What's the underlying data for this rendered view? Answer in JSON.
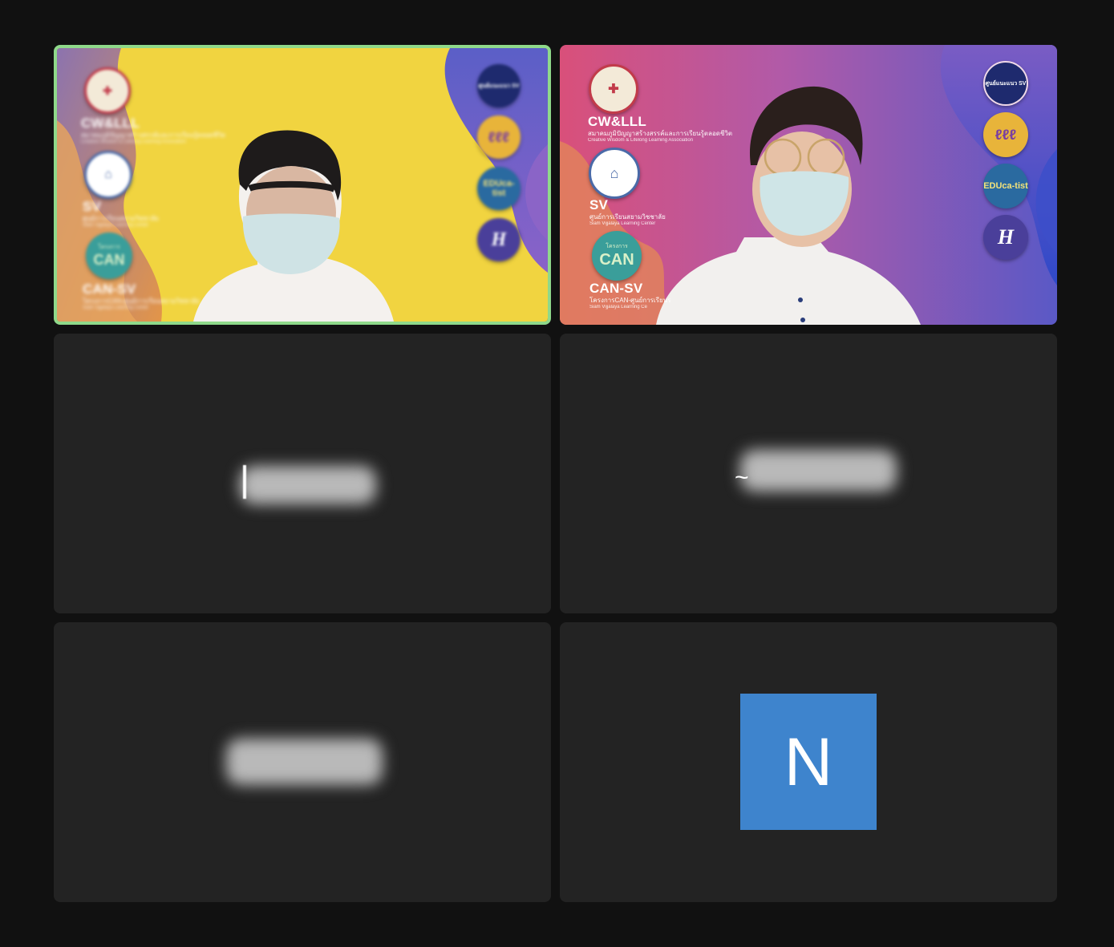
{
  "participants": [
    {
      "tile": 1,
      "active_speaker": true,
      "video_on": true,
      "background": {
        "brand_1": {
          "code": "CW&LLL",
          "thai": "สมาคมภูมิปัญญาสร้างสรรค์และการเรียนรู้ตลอดชีวิต",
          "english": "Creative Wisdom & Lifelong Learning Association"
        },
        "brand_2": {
          "code": "SV",
          "thai": "ศูนย์การเรียนสยามวิชชาลัย",
          "english": "Siam Vijjalaya Learning Center"
        },
        "brand_3": {
          "code": "CAN-SV",
          "thai": "โครงการCAN-ศูนย์การเรียนสยามวิชชาลัย",
          "english": "Siam Vijjalaya Learning Center",
          "logo_text": "CAN",
          "logo_caption": "โครงการ"
        },
        "side_logos": [
          {
            "text": "ศูนย์แนะแนว SV"
          },
          {
            "text": "ℓℓℓ"
          },
          {
            "text": "EDUca-tist"
          },
          {
            "text": "H"
          }
        ]
      }
    },
    {
      "tile": 2,
      "active_speaker": false,
      "video_on": true,
      "background": {
        "brand_1": {
          "code": "CW&LLL",
          "thai": "สมาคมภูมิปัญญาสร้างสรรค์และการเรียนรู้ตลอดชีวิต",
          "english": "Creative Wisdom & Lifelong Learning Association"
        },
        "brand_2": {
          "code": "SV",
          "thai": "ศูนย์การเรียนสยามวิชชาลัย",
          "english": "Siam Vijjalaya Learning Center"
        },
        "brand_3": {
          "code": "CAN-SV",
          "thai": "โครงการCAN-ศูนย์การเรียนร",
          "english": "Siam Vijjalaya Learning Ce",
          "logo_text": "CAN",
          "logo_caption": "โครงการ"
        },
        "side_logos": [
          {
            "text": "ศูนย์แนะแนว SV"
          },
          {
            "text": "ℓℓℓ"
          },
          {
            "text": "EDUca-tist"
          },
          {
            "text": "H"
          }
        ]
      }
    },
    {
      "tile": 3,
      "video_on": false,
      "name_redacted": true
    },
    {
      "tile": 4,
      "video_on": false,
      "name_redacted": true
    },
    {
      "tile": 5,
      "video_on": false,
      "name_redacted": true
    },
    {
      "tile": 6,
      "video_on": false,
      "avatar_initial": "N",
      "avatar_color": "#3e84cd"
    }
  ],
  "colors": {
    "window_bg": "#111111",
    "tile_bg": "#232323",
    "active_speaker_border": "#8fd98a"
  }
}
